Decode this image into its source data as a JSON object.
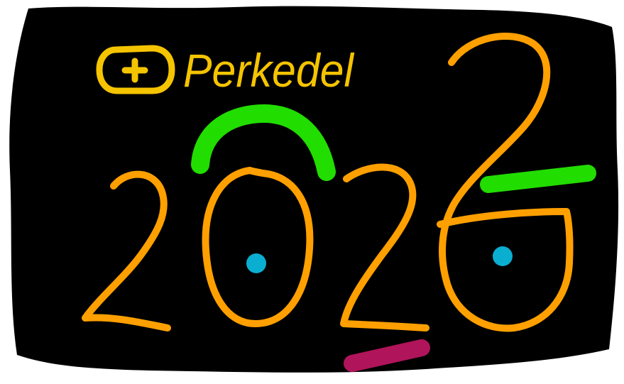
{
  "drawing": {
    "label_text": "Perkedel",
    "colors": {
      "background": "#000000",
      "paper": "#ffffff",
      "label": "#f5c400",
      "digits": "#ffa000",
      "green_marks": "#22dd00",
      "dots": "#0aaed0",
      "magenta_mark": "#b0145a"
    }
  }
}
